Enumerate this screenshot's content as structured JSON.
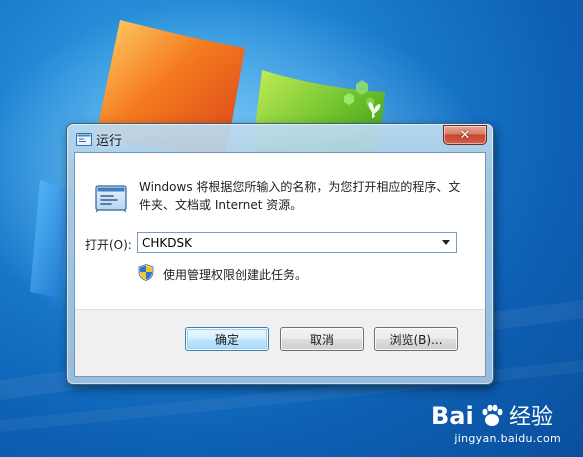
{
  "dialog": {
    "title": "运行",
    "close_icon": "close-icon",
    "description": "Windows 将根据您所输入的名称，为您打开相应的程序、文件夹、文档或 Internet 资源。",
    "open_label": "打开(O):",
    "command_value": "CHKDSK",
    "admin_note": "使用管理权限创建此任务。",
    "buttons": {
      "ok": "确定",
      "cancel": "取消",
      "browse": "浏览(B)..."
    }
  },
  "watermark": {
    "brand": "Bai 经验",
    "url": "jingyan.baidu.com"
  },
  "colors": {
    "desktop_blue": "#1c7fd0",
    "close_red": "#c4462f",
    "default_button_border": "#3c7fb1"
  }
}
